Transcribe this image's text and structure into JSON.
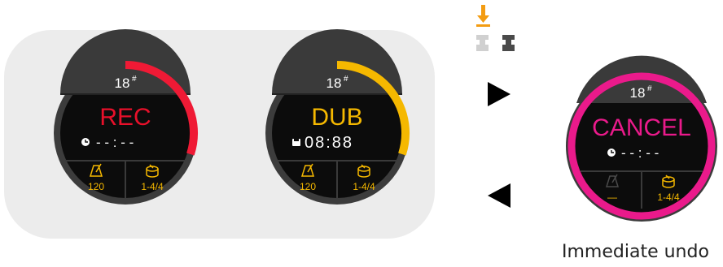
{
  "panel": {
    "dials": [
      {
        "channel": "18",
        "superscript": "#",
        "mode": "REC",
        "mode_color": "#e8102a",
        "arc_color": "#ef1a35",
        "arc_fraction": 0.3,
        "time": "- - : - -",
        "time_icon": "clock-icon",
        "tempo_icon": "metronome-icon",
        "tempo": "120",
        "pattern_icon": "drum-icon",
        "pattern": "1-4/4"
      },
      {
        "channel": "18",
        "superscript": "#",
        "mode": "DUB",
        "mode_color": "#f5b800",
        "arc_color": "#f5b800",
        "arc_fraction": 0.3,
        "time": "08:88",
        "time_icon": "save-icon",
        "tempo_icon": "metronome-icon",
        "tempo": "120",
        "pattern_icon": "drum-icon",
        "pattern": "1-4/4"
      }
    ]
  },
  "pedals": {
    "indicator_icon": "down-arrow-icon",
    "indicator_color": "#f39c12",
    "left_pedal_icon": "pedal-icon",
    "right_pedal_icon": "pedal-icon"
  },
  "transitions": {
    "forward_icon": "right-triangle-icon",
    "back_icon": "left-triangle-icon"
  },
  "cancel_dial": {
    "channel": "18",
    "superscript": "#",
    "mode": "CANCEL",
    "mode_color": "#ea1a8b",
    "ring_color": "#ea1a8b",
    "time": "- - : - -",
    "time_icon": "clock-icon",
    "tempo_icon": "metronome-icon",
    "tempo": "—",
    "pattern_icon": "drum-icon",
    "pattern": "1-4/4"
  },
  "caption": "Immediate undo",
  "colors": {
    "face": "#0c0c0c",
    "bezel": "#3c3c3c",
    "header": "#3a3a3a",
    "label": "#f5b800",
    "text": "#ffffff"
  }
}
